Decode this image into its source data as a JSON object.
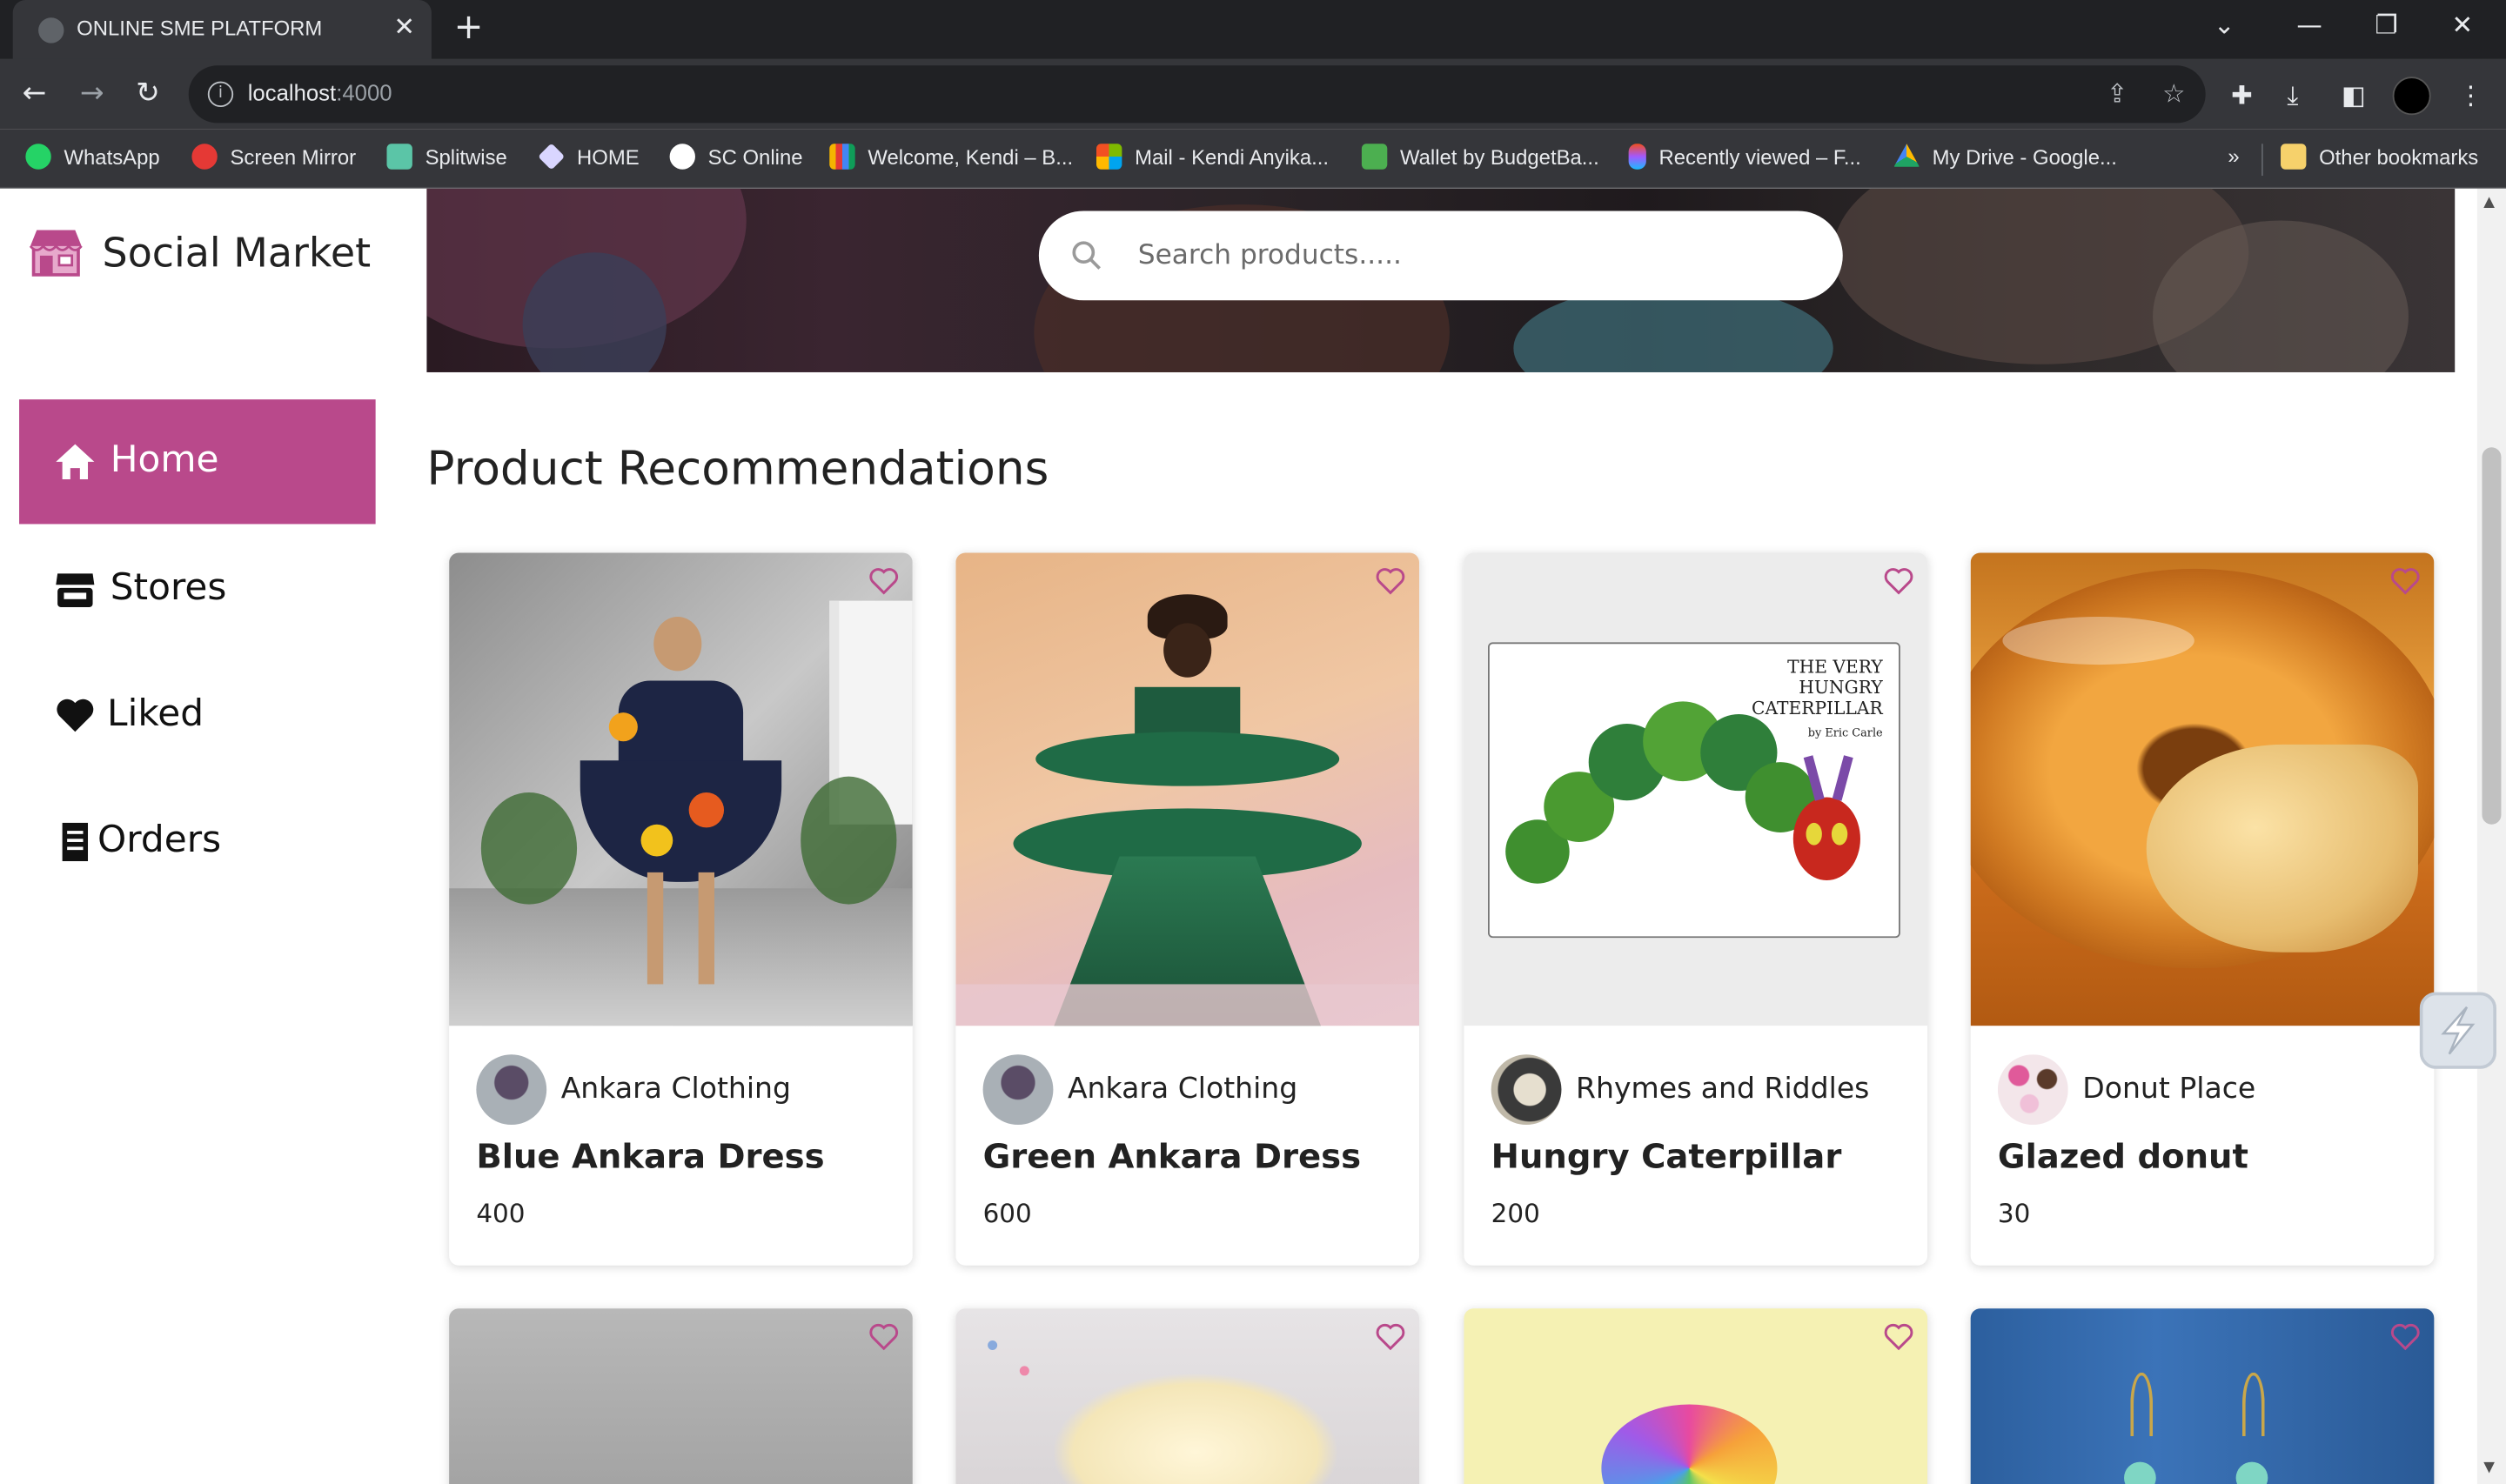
{
  "browser": {
    "tab_title": "ONLINE SME PLATFORM",
    "url_host": "localhost",
    "url_port": ":4000",
    "bookmarks": [
      {
        "label": "WhatsApp",
        "color": "#25d366"
      },
      {
        "label": "Screen Mirror",
        "color": "#e53935"
      },
      {
        "label": "Splitwise",
        "color": "#5bc5a7"
      },
      {
        "label": "HOME",
        "color": "#e0e0ff"
      },
      {
        "label": "SC Online",
        "color": "#ffffff"
      },
      {
        "label": "Welcome, Kendi – B...",
        "color": "#f4b400"
      },
      {
        "label": "Mail - Kendi Anyika...",
        "color": "#f25022"
      },
      {
        "label": "Wallet by BudgetBa...",
        "color": "#4caf50"
      },
      {
        "label": "Recently viewed – F...",
        "color": "#f24e1e"
      },
      {
        "label": "My Drive - Google...",
        "color": "#1fa463"
      }
    ],
    "bookmarks_overflow": "»",
    "other_bookmarks": "Other bookmarks"
  },
  "app": {
    "brand": "Social Market",
    "accent_color": "#b9498b",
    "nav": [
      {
        "label": "Home",
        "icon": "home-icon",
        "active": true
      },
      {
        "label": "Stores",
        "icon": "store-icon",
        "active": false
      },
      {
        "label": "Liked",
        "icon": "heart-icon",
        "active": false
      },
      {
        "label": "Orders",
        "icon": "receipt-icon",
        "active": false
      }
    ],
    "search": {
      "placeholder": "Search products....."
    },
    "section_title": "Product Recommendations",
    "products": [
      {
        "store": "Ankara Clothing",
        "name": "Blue Ankara Dress",
        "price": "400"
      },
      {
        "store": "Ankara Clothing",
        "name": "Green Ankara Dress",
        "price": "600"
      },
      {
        "store": "Rhymes and Riddles",
        "name": "Hungry Caterpillar",
        "price": "200"
      },
      {
        "store": "Donut Place",
        "name": "Glazed donut",
        "price": "30"
      }
    ],
    "book_cover_title": [
      "THE VERY",
      "HUNGRY",
      "CATERPILLAR"
    ],
    "book_cover_author": "by Eric Carle"
  }
}
